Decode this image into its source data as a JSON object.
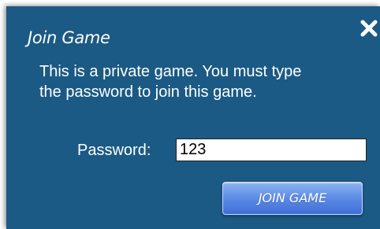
{
  "dialog": {
    "title": "Join Game",
    "message": "This is a private game.  You must type\nthe password to join this game.",
    "password_label": "Password:",
    "password_value": "123",
    "join_button_label": "JOIN GAME",
    "close_icon": "close-icon"
  },
  "colors": {
    "dialog_background": "#1b5a84",
    "text": "#ffffff",
    "button_top": "#8fb4f2",
    "button_bottom": "#3f6fd6"
  }
}
